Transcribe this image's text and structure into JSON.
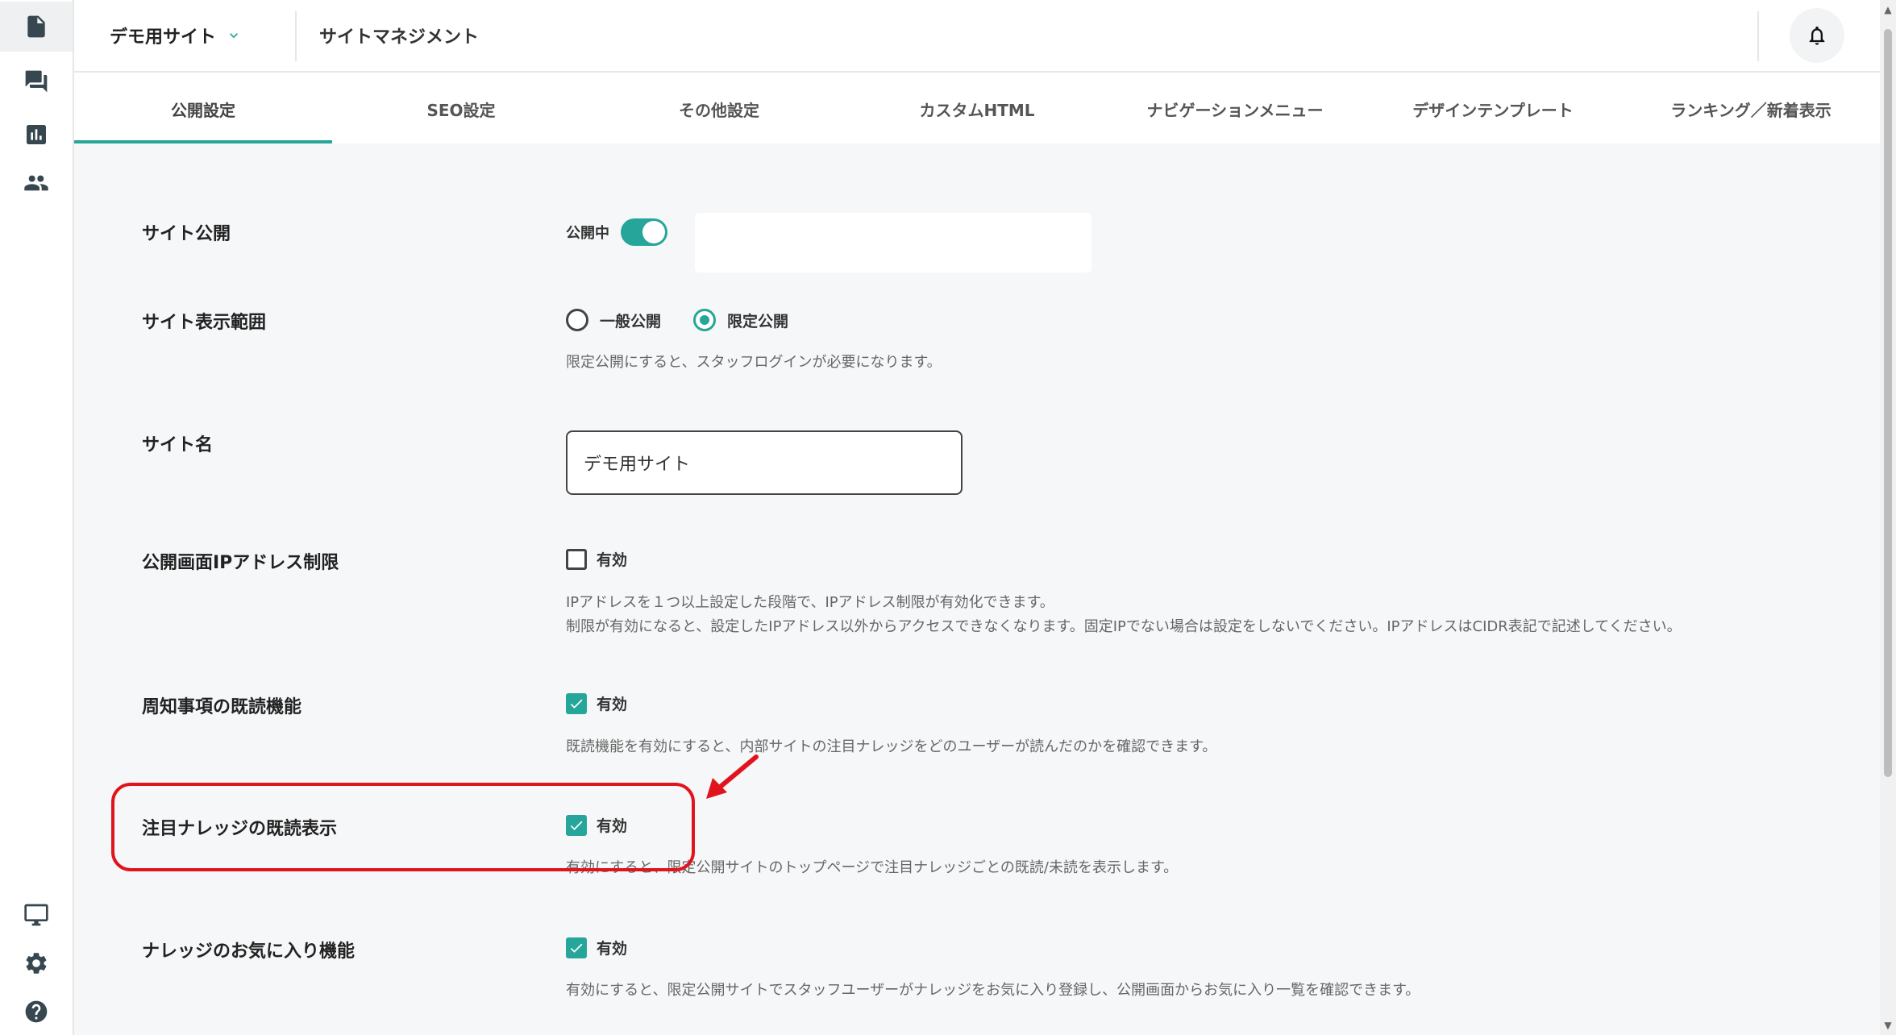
{
  "header": {
    "site_name": "デモ用サイト",
    "title": "サイトマネジメント"
  },
  "tabs": [
    {
      "label": "公開設定",
      "active": true
    },
    {
      "label": "SEO設定"
    },
    {
      "label": "その他設定"
    },
    {
      "label": "カスタムHTML"
    },
    {
      "label": "ナビゲーションメニュー"
    },
    {
      "label": "デザインテンプレート"
    },
    {
      "label": "ランキング／新着表示"
    }
  ],
  "rail": {
    "top_icons": [
      "document-icon",
      "chat-icon",
      "bar-chart-icon",
      "people-icon"
    ],
    "bottom_icons": [
      "monitor-icon",
      "gear-icon",
      "help-icon"
    ]
  },
  "settings": {
    "site_public": {
      "label": "サイト公開",
      "toggle_text": "公開中",
      "on": true
    },
    "visibility": {
      "label": "サイト表示範囲",
      "options": [
        "一般公開",
        "限定公開"
      ],
      "selected": "限定公開",
      "description": "限定公開にすると、スタッフログインが必要になります。"
    },
    "site_name": {
      "label": "サイト名",
      "value": "デモ用サイト"
    },
    "ip_restriction": {
      "label": "公開画面IPアドレス制限",
      "checkbox_label": "有効",
      "checked": false,
      "description_1": "IPアドレスを１つ以上設定した段階で、IPアドレス制限が有効化できます。",
      "description_2": "制限が有効になると、設定したIPアドレス以外からアクセスできなくなります。固定IPでない場合は設定をしないでください。IPアドレスはCIDR表記で記述してください。"
    },
    "notice_read": {
      "label": "周知事項の既読機能",
      "checkbox_label": "有効",
      "checked": true,
      "description": "既読機能を有効にすると、内部サイトの注目ナレッジをどのユーザーが読んだのかを確認できます。"
    },
    "featured_read": {
      "label": "注目ナレッジの既読表示",
      "checkbox_label": "有効",
      "checked": true,
      "description": "有効にすると、限定公開サイトのトップページで注目ナレッジごとの既読/未読を表示します。"
    },
    "favorites": {
      "label": "ナレッジのお気に入り機能",
      "checkbox_label": "有効",
      "checked": true,
      "description": "有効にすると、限定公開サイトでスタッフユーザーがナレッジをお気に入り登録し、公開画面からお気に入り一覧を確認できます。"
    }
  },
  "colors": {
    "accent": "#26a69a",
    "highlight": "#e0141e"
  }
}
